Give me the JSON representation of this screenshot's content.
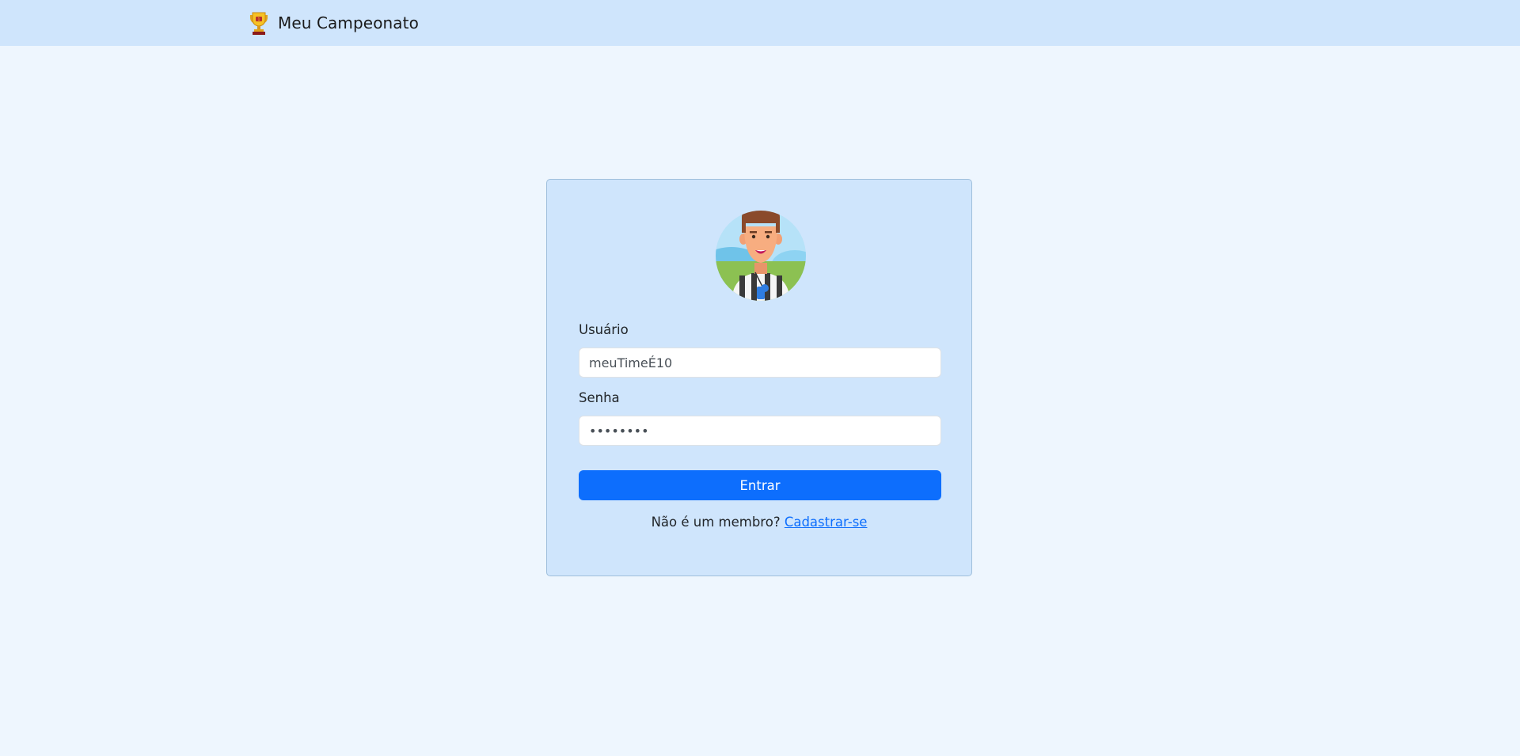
{
  "navbar": {
    "brand_text": "Meu Campeonato",
    "brand_icon": "trophy-icon",
    "background": "#cfe5fc"
  },
  "login": {
    "avatar_icon": "referee-avatar",
    "username_label": "Usuário",
    "username_value": "meuTimeÉ10",
    "password_label": "Senha",
    "password_value": "12345678",
    "submit_label": "Entrar",
    "signup_prompt": "Não é um membro?",
    "signup_link": "Cadastrar-se"
  },
  "colors": {
    "page_background": "#eef6fe",
    "card_background": "#cfe5fc",
    "primary": "#0d6efd"
  }
}
